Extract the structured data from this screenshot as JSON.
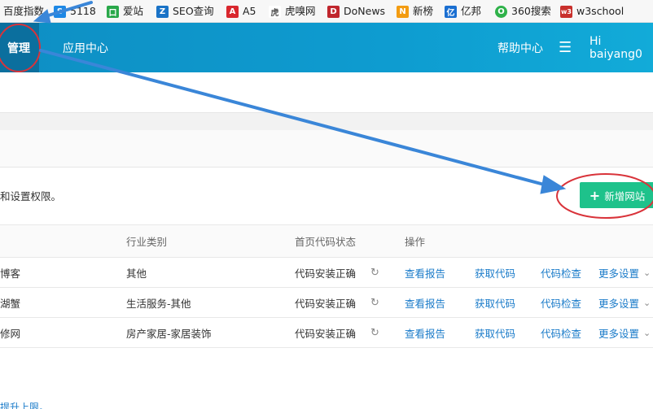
{
  "bookmarks": [
    {
      "label": "百度指数",
      "icon": "baidu-index-icon",
      "color": "#2f6fde",
      "glyph": ""
    },
    {
      "label": "5118",
      "icon": "s5118-icon",
      "color": "#1e88e5",
      "glyph": "S"
    },
    {
      "label": "爱站",
      "icon": "aizhan-icon",
      "color": "#2aa84a",
      "glyph": "口"
    },
    {
      "label": "SEO查询",
      "icon": "seo-icon",
      "color": "#1a73c7",
      "glyph": "Z"
    },
    {
      "label": "A5",
      "icon": "a5-icon",
      "color": "#d9272e",
      "glyph": "A"
    },
    {
      "label": "虎嗅网",
      "icon": "huxiu-icon",
      "color": "#666666",
      "glyph": "虎"
    },
    {
      "label": "DoNews",
      "icon": "donews-icon",
      "color": "#c0262d",
      "glyph": "D"
    },
    {
      "label": "新榜",
      "icon": "xinbang-icon",
      "color": "#f39c12",
      "glyph": "N"
    },
    {
      "label": "亿邦",
      "icon": "yibang-icon",
      "color": "#1b6fd1",
      "glyph": "亿"
    },
    {
      "label": "360搜索",
      "icon": "so360-icon",
      "color": "#2fb24a",
      "glyph": "O"
    },
    {
      "label": "w3school",
      "icon": "w3school-icon",
      "color": "#c9302c",
      "glyph": "w3"
    }
  ],
  "header": {
    "manage": "管理",
    "app_center": "应用中心",
    "help": "帮助中心",
    "menu_glyph": "☰",
    "user": "Hi  baiyang0"
  },
  "description": "和设置权限。",
  "add_button": {
    "plus": "+",
    "label": "新增网站"
  },
  "table": {
    "headers": {
      "industry": "行业类别",
      "status": "首页代码状态",
      "action": "操作"
    },
    "rows": [
      {
        "name": "博客",
        "industry": "其他",
        "status": "代码安装正确",
        "report": "查看报告",
        "get_code": "获取代码",
        "check": "代码检查",
        "more": "更多设置"
      },
      {
        "name": "湖蟹",
        "industry": "生活服务-其他",
        "status": "代码安装正确",
        "report": "查看报告",
        "get_code": "获取代码",
        "check": "代码检查",
        "more": "更多设置"
      },
      {
        "name": "修网",
        "industry": "房产家居-家居装饰",
        "status": "代码安装正确",
        "report": "查看报告",
        "get_code": "获取代码",
        "check": "代码检查",
        "more": "更多设置"
      }
    ],
    "refresh_glyph": "↻",
    "chevron_glyph": "⌄"
  },
  "limit_link": "提升上限。",
  "annotation_color": "#3a86d8",
  "circle_color": "#d9333a"
}
